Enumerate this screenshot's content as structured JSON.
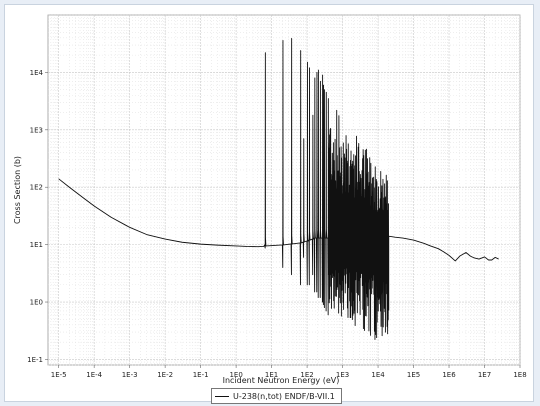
{
  "chart_data": {
    "type": "line",
    "title": "",
    "xlabel": "Incident Neutron Energy (eV)",
    "ylabel": "Cross Section (b)",
    "xscale": "log",
    "yscale": "log",
    "xlim": [
      5e-06,
      100000000.0
    ],
    "ylim": [
      0.08,
      100000.0
    ],
    "x_ticks": [
      "1E-5",
      "1E-4",
      "1E-3",
      "1E-2",
      "1E-1",
      "1E0",
      "1E1",
      "1E2",
      "1E3",
      "1E4",
      "1E5",
      "1E6",
      "1E7",
      "1E8"
    ],
    "y_ticks": [
      "1E-1",
      "1E0",
      "1E1",
      "1E2",
      "1E3",
      "1E4"
    ],
    "grid": true,
    "legend_position": "bottom-center",
    "series": [
      {
        "name": "U-238(n,tot) ENDF/B-VII.1",
        "color": "#111111",
        "smooth": {
          "x": [
            1e-05,
            2e-05,
            5e-05,
            0.0001,
            0.0003,
            0.001,
            0.003,
            0.01,
            0.03,
            0.1,
            0.3,
            1,
            2,
            4,
            6,
            6.5
          ],
          "y": [
            140,
            100,
            65,
            47,
            30,
            20,
            15,
            12.5,
            11,
            10.2,
            9.8,
            9.5,
            9.3,
            9.2,
            9.3,
            10
          ]
        },
        "resolved_resonances": [
          {
            "x": 6.67,
            "peak": 22000,
            "dip": 8.7
          },
          {
            "x": 20.9,
            "peak": 36000,
            "dip": 4
          },
          {
            "x": 36.7,
            "peak": 39000,
            "dip": 3
          },
          {
            "x": 66,
            "peak": 24000,
            "dip": 2
          },
          {
            "x": 80.7,
            "peak": 700,
            "dip": 6
          },
          {
            "x": 102.5,
            "peak": 15000,
            "dip": 2
          },
          {
            "x": 116.9,
            "peak": 12000,
            "dip": 2
          },
          {
            "x": 145.7,
            "peak": 1800,
            "dip": 3
          },
          {
            "x": 165.3,
            "peak": 8000,
            "dip": 1.5
          },
          {
            "x": 189.6,
            "peak": 10000,
            "dip": 1.5
          },
          {
            "x": 208.5,
            "peak": 11000,
            "dip": 1.2
          },
          {
            "x": 237.4,
            "peak": 7000,
            "dip": 1.2
          },
          {
            "x": 273.7,
            "peak": 9000,
            "dip": 1.0
          },
          {
            "x": 291,
            "peak": 6000,
            "dip": 0.9
          },
          {
            "x": 311,
            "peak": 5000,
            "dip": 0.8
          },
          {
            "x": 347.8,
            "peak": 4500,
            "dip": 0.7
          },
          {
            "x": 397.5,
            "peak": 3500,
            "dip": 0.6
          }
        ],
        "dense_resonance_region": {
          "x_start": 400,
          "x_end": 20000,
          "upper_start": 4000,
          "upper_end": 150,
          "lower_start": 0.8,
          "lower_end": 0.15,
          "baseline": 12
        },
        "unresolved_region": {
          "x": [
            20000,
            30000.0,
            50000.0,
            100000.0,
            200000.0,
            300000.0,
            500000.0,
            700000.0,
            1000000.0,
            1500000.0,
            2000000.0,
            3000000.0,
            4000000.0,
            5000000.0,
            7000000.0,
            10000000.0,
            13000000.0,
            16000000.0,
            20000000.0,
            25000000.0
          ],
          "y": [
            14,
            13.5,
            13,
            12,
            10.5,
            9.5,
            8.5,
            7.5,
            6.5,
            5.2,
            6.3,
            7.3,
            6.3,
            5.9,
            5.6,
            6.1,
            5.4,
            5.4,
            6.0,
            5.6
          ]
        }
      }
    ]
  }
}
